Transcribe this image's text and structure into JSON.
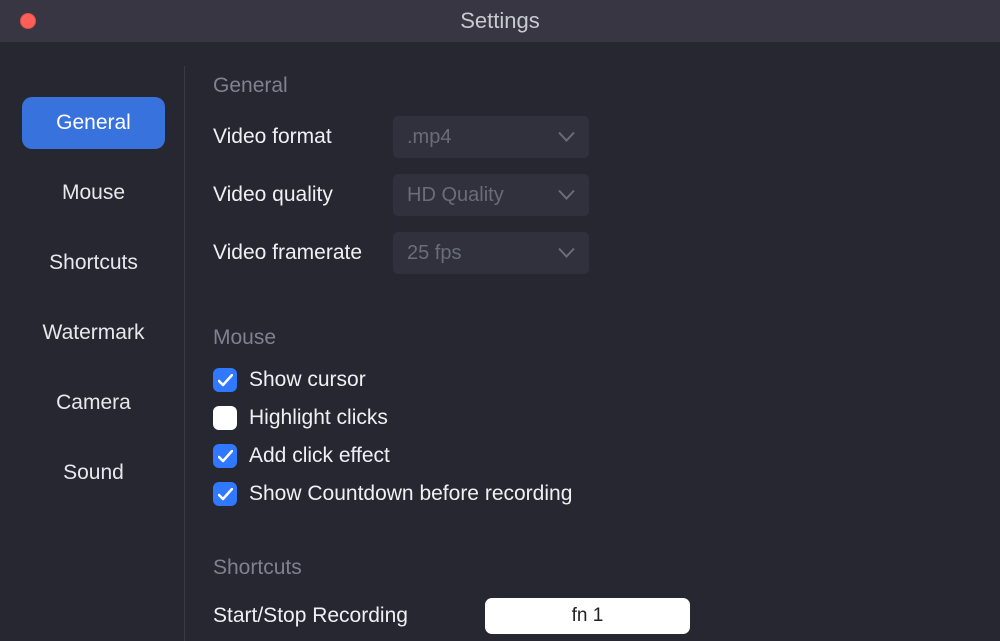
{
  "window": {
    "title": "Settings"
  },
  "sidebar": {
    "items": [
      {
        "label": "General",
        "active": true
      },
      {
        "label": "Mouse",
        "active": false
      },
      {
        "label": "Shortcuts",
        "active": false
      },
      {
        "label": "Watermark",
        "active": false
      },
      {
        "label": "Camera",
        "active": false
      },
      {
        "label": "Sound",
        "active": false
      }
    ]
  },
  "sections": {
    "general": {
      "title": "General",
      "rows": {
        "video_format": {
          "label": "Video format",
          "value": ".mp4"
        },
        "video_quality": {
          "label": "Video quality",
          "value": "HD Quality"
        },
        "video_framerate": {
          "label": "Video framerate",
          "value": "25 fps"
        }
      }
    },
    "mouse": {
      "title": "Mouse",
      "options": {
        "show_cursor": {
          "label": "Show cursor",
          "checked": true
        },
        "highlight_clicks": {
          "label": "Highlight clicks",
          "checked": false
        },
        "add_click_effect": {
          "label": "Add click effect",
          "checked": true
        },
        "show_countdown": {
          "label": "Show Countdown before recording",
          "checked": true
        }
      }
    },
    "shortcuts": {
      "title": "Shortcuts",
      "start_stop": {
        "label": "Start/Stop Recording",
        "value": "fn 1"
      }
    }
  }
}
